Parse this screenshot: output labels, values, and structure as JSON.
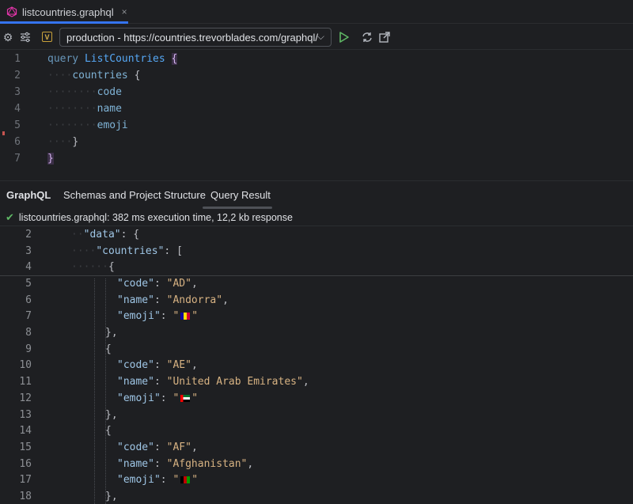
{
  "tab": {
    "filename": "listcountries.graphql",
    "close": "×"
  },
  "toolbar": {
    "badge": "V",
    "endpoint": "production - https://countries.trevorblades.com/graphql/",
    "icons": [
      "gear-icon",
      "sliders-icon",
      "run-icon",
      "refresh-icon",
      "open-external-icon"
    ]
  },
  "editor": {
    "lines": [
      {
        "n": "1",
        "text": "query ListCountries {"
      },
      {
        "n": "2",
        "text": "countries {"
      },
      {
        "n": "3",
        "text": "code"
      },
      {
        "n": "4",
        "text": "name"
      },
      {
        "n": "5",
        "text": "emoji"
      },
      {
        "n": "6",
        "text": "}"
      },
      {
        "n": "7",
        "text": "}"
      }
    ],
    "keyword": "query",
    "operation": "ListCountries"
  },
  "panel": {
    "tabs": [
      "GraphQL",
      "Schemas and Project Structure",
      "Query Result"
    ],
    "status": "listcountries.graphql: 382 ms execution time, 12,2 kb response"
  },
  "result": {
    "lines": [
      {
        "n": "2",
        "key": "data",
        "tail": ": {"
      },
      {
        "n": "3",
        "key": "countries",
        "tail": ": ["
      },
      {
        "n": "4",
        "brace": "{"
      },
      {
        "n": "5",
        "key": "code",
        "val": "AD"
      },
      {
        "n": "6",
        "key": "name",
        "val": "Andorra"
      },
      {
        "n": "7",
        "key": "emoji",
        "flag": "AD"
      },
      {
        "n": "8",
        "brace": "},"
      },
      {
        "n": "9",
        "brace": "{"
      },
      {
        "n": "10",
        "key": "code",
        "val": "AE"
      },
      {
        "n": "11",
        "key": "name",
        "val": "United Arab Emirates"
      },
      {
        "n": "12",
        "key": "emoji",
        "flag": "AE"
      },
      {
        "n": "13",
        "brace": "},"
      },
      {
        "n": "14",
        "brace": "{"
      },
      {
        "n": "15",
        "key": "code",
        "val": "AF"
      },
      {
        "n": "16",
        "key": "name",
        "val": "Afghanistan"
      },
      {
        "n": "17",
        "key": "emoji",
        "flag": "AF"
      },
      {
        "n": "18",
        "brace": "},"
      }
    ]
  }
}
